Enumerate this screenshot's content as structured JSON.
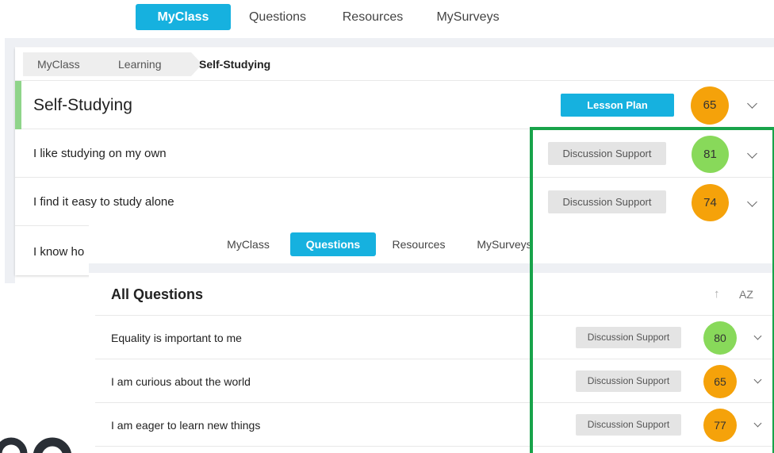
{
  "main_nav": {
    "tabs": [
      {
        "label": "MyClass",
        "active": true
      },
      {
        "label": "Questions",
        "active": false
      },
      {
        "label": "Resources",
        "active": false
      },
      {
        "label": "MySurveys",
        "active": false
      }
    ]
  },
  "breadcrumb": {
    "items": [
      "MyClass",
      "Learning",
      "Self-Studying"
    ]
  },
  "section": {
    "title": "Self-Studying",
    "button_label": "Lesson Plan",
    "score": "65",
    "score_color": "#f5a20a"
  },
  "section_rows": [
    {
      "title": "I like studying on my own",
      "button_label": "Discussion Support",
      "score": "81",
      "score_color": "#88d95a"
    },
    {
      "title": "I find it easy to study alone",
      "button_label": "Discussion Support",
      "score": "74",
      "score_color": "#f5a20a"
    },
    {
      "title": "I know ho"
    }
  ],
  "overlay_nav": {
    "tabs": [
      {
        "label": "MyClass",
        "active": false
      },
      {
        "label": "Questions",
        "active": true
      },
      {
        "label": "Resources",
        "active": false
      },
      {
        "label": "MySurveys",
        "active": false
      }
    ]
  },
  "all_questions": {
    "title": "All Questions",
    "sort_up_icon": "↑",
    "sort_az_label": "AZ",
    "rows": [
      {
        "title": "Equality is important to me",
        "button_label": "Discussion Support",
        "score": "80",
        "score_color": "#88d95a"
      },
      {
        "title": "I am curious about the world",
        "button_label": "Discussion Support",
        "score": "65",
        "score_color": "#f5a20a"
      },
      {
        "title": "I am eager to learn new things",
        "button_label": "Discussion Support",
        "score": "77",
        "score_color": "#f5a20a"
      }
    ]
  },
  "colors": {
    "accent": "#16b1df",
    "highlight": "#18a34a",
    "orange": "#f5a20a",
    "green": "#88d95a"
  }
}
